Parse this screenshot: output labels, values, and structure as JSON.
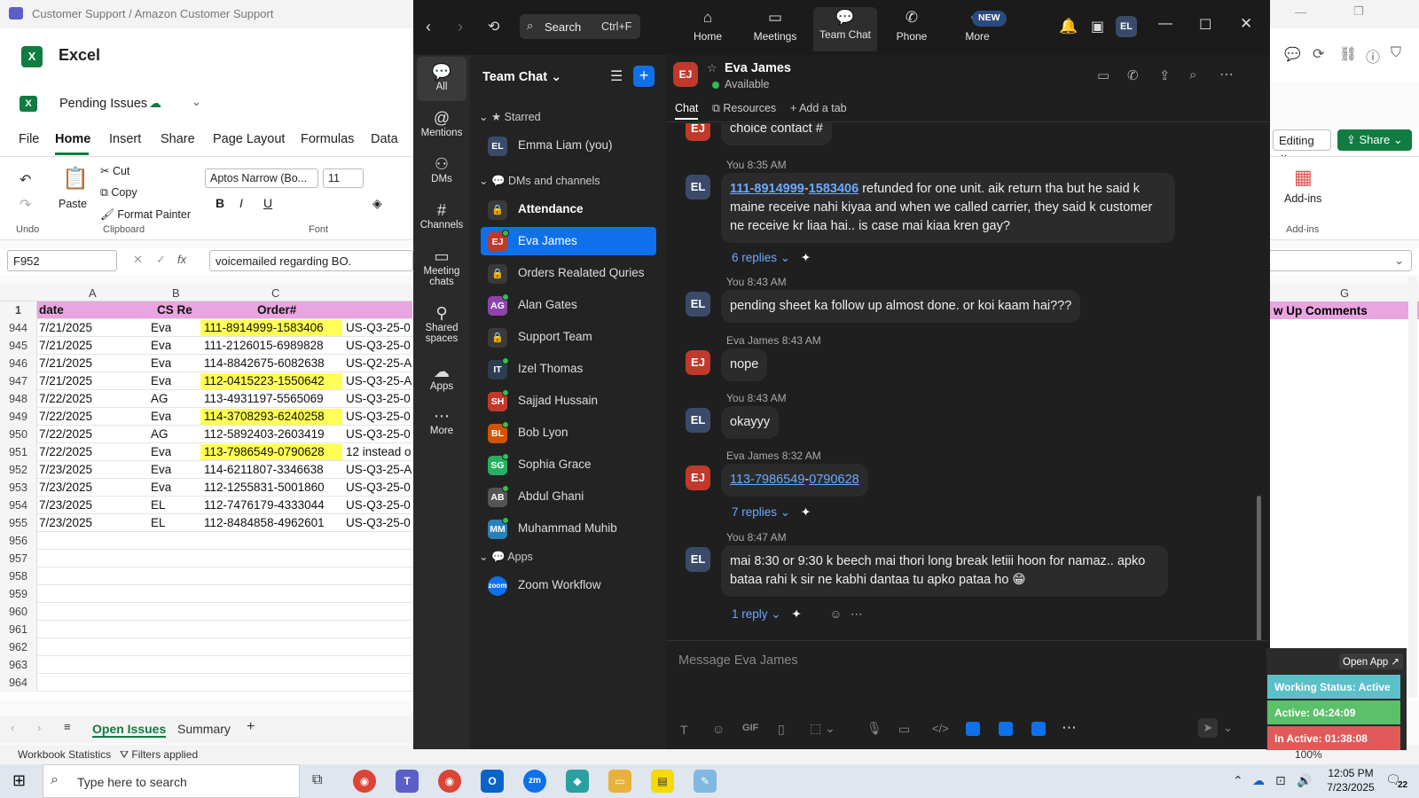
{
  "excel": {
    "window_title": "Customer Support / Amazon Customer Support",
    "app_name": "Excel",
    "file_name": "Pending Issues",
    "menu": [
      "File",
      "Home",
      "Insert",
      "Share",
      "Page Layout",
      "Formulas",
      "Data"
    ],
    "editing_label": "Editing",
    "share_label": "Share",
    "ribbon": {
      "undo": "Undo",
      "paste": "Paste",
      "cut": "Cut",
      "copy": "Copy",
      "format_painter": "Format Painter",
      "clipboard_group": "Clipboard",
      "font_name": "Aptos Narrow (Bo...",
      "font_size": "11",
      "font_group": "Font",
      "addins": "Add-ins",
      "addins_group": "Add-ins"
    },
    "name_box": "F952",
    "formula": "voicemailed regarding BO.",
    "col_headers": [
      "A",
      "B",
      "C",
      "G"
    ],
    "header_row": {
      "num": "1",
      "a": "date",
      "b": "CS Re",
      "c": "Order#",
      "g": "w Up Comments"
    },
    "rows": [
      {
        "num": "944",
        "date": "7/21/2025",
        "cs": "Eva",
        "order": "111-8914999-1583406",
        "d": "US-Q3-25-0",
        "hl": true
      },
      {
        "num": "945",
        "date": "7/21/2025",
        "cs": "Eva",
        "order": "111-2126015-6989828",
        "d": "US-Q3-25-0",
        "hl": false
      },
      {
        "num": "946",
        "date": "7/21/2025",
        "cs": "Eva",
        "order": "114-8842675-6082638",
        "d": "US-Q2-25-A",
        "hl": false
      },
      {
        "num": "947",
        "date": "7/21/2025",
        "cs": "Eva",
        "order": "112-0415223-1550642",
        "d": "US-Q3-25-A",
        "hl": true
      },
      {
        "num": "948",
        "date": "7/22/2025",
        "cs": "AG",
        "order": "113-4931197-5565069",
        "d": "US-Q3-25-0",
        "hl": false
      },
      {
        "num": "949",
        "date": "7/22/2025",
        "cs": "Eva",
        "order": "114-3708293-6240258",
        "d": "US-Q3-25-0",
        "hl": true
      },
      {
        "num": "950",
        "date": "7/22/2025",
        "cs": "AG",
        "order": "112-5892403-2603419",
        "d": "US-Q3-25-0",
        "hl": false
      },
      {
        "num": "951",
        "date": "7/22/2025",
        "cs": "Eva",
        "order": "113-7986549-0790628",
        "d": "12 instead o",
        "hl": true
      },
      {
        "num": "952",
        "date": "7/23/2025",
        "cs": "Eva",
        "order": "114-6211807-3346638",
        "d": "US-Q3-25-A",
        "hl": false
      },
      {
        "num": "953",
        "date": "7/23/2025",
        "cs": "Eva",
        "order": "112-1255831-5001860",
        "d": "US-Q3-25-0",
        "hl": false
      },
      {
        "num": "954",
        "date": "7/23/2025",
        "cs": "EL",
        "order": "112-7476179-4333044",
        "d": "US-Q3-25-0",
        "hl": false
      },
      {
        "num": "955",
        "date": "7/23/2025",
        "cs": "EL",
        "order": "112-8484858-4962601",
        "d": "US-Q3-25-0",
        "hl": false
      }
    ],
    "empty_rows": [
      "956",
      "957",
      "958",
      "959",
      "960",
      "961",
      "962",
      "963",
      "964"
    ],
    "sheets": [
      "Open Issues",
      "Summary"
    ],
    "status_left": "Workbook Statistics",
    "filters": "Filters applied",
    "zoom": "100%"
  },
  "zoom": {
    "search_placeholder": "Search",
    "search_shortcut": "Ctrl+F",
    "nav": [
      "Home",
      "Meetings",
      "Team Chat",
      "Phone",
      "More"
    ],
    "new_badge": "NEW",
    "user_initials": "EL",
    "rail": [
      "All",
      "Mentions",
      "DMs",
      "Channels",
      "Meeting chats",
      "Shared spaces",
      "Apps",
      "More"
    ],
    "list_title": "Team Chat",
    "sections": {
      "starred": "Starred",
      "dms": "DMs and channels",
      "apps": "Apps"
    },
    "starred_item": "Emma Liam (you)",
    "items": [
      {
        "name": "Attendance",
        "av": "lock",
        "color": "#3a3a3a",
        "bold": true
      },
      {
        "name": "Eva James",
        "av": "EJ",
        "color": "#c0392b",
        "active": true
      },
      {
        "name": "Orders Realated Quries",
        "av": "lock",
        "color": "#3a3a3a"
      },
      {
        "name": "Alan Gates",
        "av": "AG",
        "color": "#8e44ad"
      },
      {
        "name": "Support Team",
        "av": "lock",
        "color": "#3a3a3a"
      },
      {
        "name": "Izel Thomas",
        "av": "IT",
        "color": "#2c3e50"
      },
      {
        "name": "Sajjad Hussain",
        "av": "SH",
        "color": "#c0392b"
      },
      {
        "name": "Bob Lyon",
        "av": "BL",
        "color": "#d35400"
      },
      {
        "name": "Sophia Grace",
        "av": "SG",
        "color": "#27ae60"
      },
      {
        "name": "Abdul Ghani",
        "av": "AB",
        "color": "#555"
      },
      {
        "name": "Muhammad Muhib",
        "av": "MM",
        "color": "#2980b9"
      }
    ],
    "app_item": "Zoom Workflow",
    "contact_name": "Eva James",
    "contact_status": "Available",
    "tabs": [
      "Chat",
      "Resources",
      "Add a tab"
    ],
    "messages": {
      "m0": "choice contact #",
      "m1_meta": "You 8:35 AM",
      "m1_link1": "111-8914999",
      "m1_link2": "1583406",
      "m1_text": " refunded for one unit. aik return tha but he said k maine receive nahi kiyaa and when we called carrier, they said k customer ne receive kr liaa hai.. is case mai kiaa kren gay?",
      "m1_replies": "6 replies",
      "m2_meta": "You 8:43 AM",
      "m2_text": "pending sheet ka follow up almost done. or koi kaam hai???",
      "m3_meta": "Eva James 8:43 AM",
      "m3_text": "nope",
      "m4_meta": "You 8:43 AM",
      "m4_text": "okayyy",
      "m5_meta": "Eva James 8:32 AM",
      "m5_link1": "113-7986549",
      "m5_link2": "0790628",
      "m5_replies": "7 replies",
      "m6_meta": "You 8:47 AM",
      "m6_text": "mai 8:30 or 9:30 k beech mai thori long break letiii hoon for namaz.. apko bataa rahi k sir ne kabhi dantaa tu apko pataa ho 😁",
      "m6_replies": "1 reply"
    },
    "compose_placeholder": "Message Eva James"
  },
  "status_widget": {
    "open_app": "Open App ↗",
    "working": "Working Status: Active",
    "active": "Active: 04:24:09",
    "inactive": "In Active: 01:38:08"
  },
  "taskbar": {
    "search": "Type here to search",
    "time": "12:05 PM",
    "date": "7/23/2025",
    "notif": "22"
  }
}
